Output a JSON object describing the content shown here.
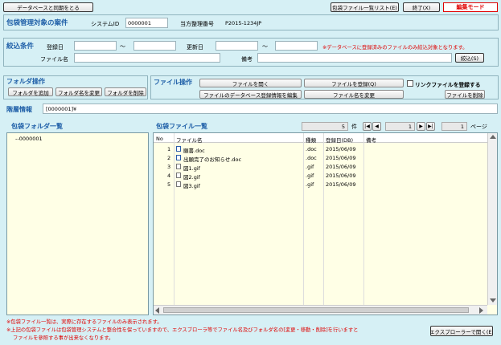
{
  "toolbar": {
    "sync_label": "データベースと同期をとる",
    "file_list_label": "包袋ファイル一覧リスト(E)",
    "exit_label": "終了(X)",
    "edit_mode_label": "編集モード"
  },
  "target": {
    "title": "包袋管理対象の案件",
    "system_id_label": "システムID",
    "system_id_value": "0000001",
    "agent_no_label": "当方整理番号",
    "agent_no_value": "P2015-1234JP"
  },
  "filter": {
    "title": "絞込条件",
    "reg_date_label": "登録日",
    "update_date_label": "更新日",
    "tilde": "～",
    "note": "※データベースに登録済みのファイルのみ絞込対象となります。",
    "filename_label": "ファイル名",
    "remarks_label": "備考",
    "apply_label": "絞込(S)"
  },
  "folder_ops": {
    "title": "フォルダ操作",
    "add_label": "フォルダを追加",
    "rename_label": "フォルダ名を変更",
    "delete_label": "フォルダを削除"
  },
  "file_ops": {
    "title": "ファイル操作",
    "open_label": "ファイルを開く",
    "register_label": "ファイルを登録(Q)",
    "link_checkbox_label": "リンクファイルを登録する",
    "edit_db_label": "ファイルのデータベース登録情報を編集",
    "rename_label": "ファイル名を変更",
    "delete_label": "ファイルを削除"
  },
  "hierarchy": {
    "label": "階層情報",
    "value": "[0000001]¥"
  },
  "folder_list": {
    "title": "包袋フォルダ一覧",
    "items": [
      "--0000001"
    ]
  },
  "file_list": {
    "title": "包袋ファイル一覧",
    "count": "5",
    "count_unit": "件",
    "page": "1",
    "page_total": "1",
    "page_unit": "ページ",
    "columns": [
      "No",
      "ファイル名",
      "種類",
      "登録日(DB)",
      "備考"
    ],
    "rows": [
      {
        "no": "1",
        "name": "願書.doc",
        "type": ".doc",
        "date": "2015/06/09",
        "remarks": ""
      },
      {
        "no": "2",
        "name": "出願完了のお知らせ.doc",
        "type": ".doc",
        "date": "2015/06/09",
        "remarks": ""
      },
      {
        "no": "3",
        "name": "図1.gif",
        "type": ".gif",
        "date": "2015/06/09",
        "remarks": ""
      },
      {
        "no": "4",
        "name": "図2.gif",
        "type": ".gif",
        "date": "2015/06/09",
        "remarks": ""
      },
      {
        "no": "5",
        "name": "図3.gif",
        "type": ".gif",
        "date": "2015/06/09",
        "remarks": ""
      }
    ]
  },
  "footer": {
    "note1": "※包袋ファイル一覧は、実際に存在するファイルのみ表示されます。",
    "note2": "※上記の包袋ファイルは包袋管理システムと整合性を保っていますので、エクスプローラ等でファイル名及びフォルダ名の[変更・移動・削除]を行いますと",
    "note3": "ファイルを參照する事が出来なくなります。",
    "explorer_label": "エクスプローラーで開く(E)"
  },
  "colors": {
    "bg": "#d6f0f5",
    "title_blue": "#1f5fa8",
    "red": "#e00000",
    "panel": "#ffffe6"
  }
}
